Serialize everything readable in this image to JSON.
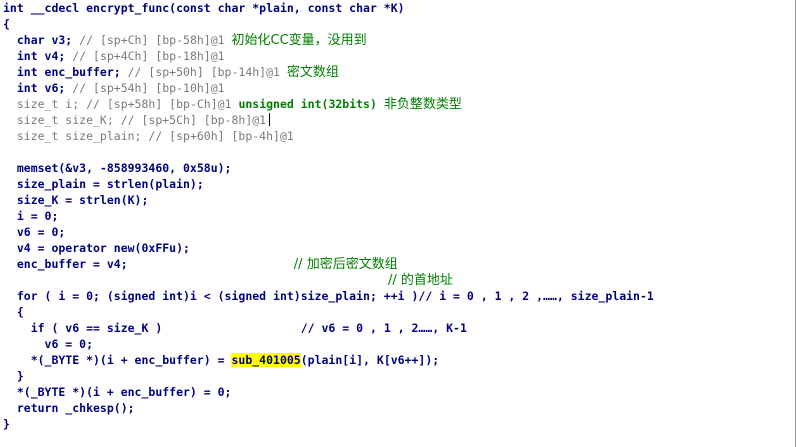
{
  "sig": {
    "head": "int __cdecl encrypt_func(const char *plain, const char *K)"
  },
  "braces": {
    "open": "{",
    "close": "}"
  },
  "decl": [
    {
      "code": "  char v3; ",
      "comment": "// [sp+Ch] [bp-58h]@1",
      "note": "初始化CC变量，没用到"
    },
    {
      "code": "  int v4; ",
      "comment": "// [sp+4Ch] [bp-18h]@1",
      "note": ""
    },
    {
      "code": "  int enc_buffer; ",
      "comment": "// [sp+50h] [bp-14h]@1",
      "note": "密文数组"
    },
    {
      "code": "  int v6; ",
      "comment": "// [sp+54h] [bp-10h]@1",
      "note": ""
    },
    {
      "code": "  size_t i; ",
      "comment": "// [sp+58h] [bp-Ch]@1",
      "note_code": "unsigned int(32bits)",
      "note": "非负整数类型"
    },
    {
      "code": "  size_t size_K; ",
      "comment": "// [sp+5Ch] [bp-8h]@1",
      "note": ""
    },
    {
      "code": "  size_t size_plain; ",
      "comment": "// [sp+60h] [bp-4h]@1",
      "note": ""
    }
  ],
  "body": [
    "  memset(&v3, -858993460, 0x58u);",
    "  size_plain = strlen(plain);",
    "  size_K = strlen(K);",
    "  i = 0;",
    "  v6 = 0;",
    "  v4 = operator new(0xFFu);"
  ],
  "enc_line": {
    "code": "  enc_buffer = v4;",
    "pad": "                        ",
    "comment1": "// 加密后密文数组",
    "comment2": "// 的首地址"
  },
  "for_line": {
    "code": "  for ( i = 0; (signed int)i < (signed int)size_plain; ++i )",
    "comment": "// i = 0 , 1 , 2 ,……, size_plain-1"
  },
  "if_line": {
    "code": "    if ( v6 == size_K )",
    "pad": "                    ",
    "comment": "// v6 = 0 , 1 , 2……, K-1"
  },
  "inner": {
    "brace_open": "  {",
    "reset": "      v6 = 0;",
    "assign_pre": "    *(_BYTE *)(i + enc_buffer) = ",
    "call": "sub_401005",
    "assign_post": "(plain[i], K[v6++]);",
    "brace_close": "  }"
  },
  "tail": [
    "  *(_BYTE *)(i + enc_buffer) = 0;",
    "  return _chkesp();"
  ]
}
